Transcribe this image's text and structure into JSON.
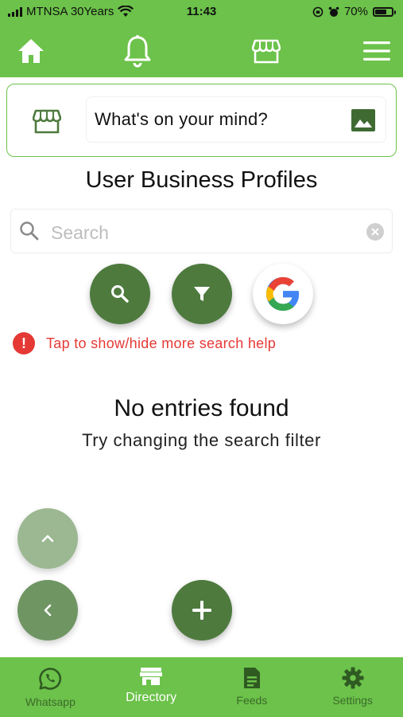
{
  "status_bar": {
    "carrier": "MTNSA 30Years",
    "time": "11:43",
    "battery_percent": "70%",
    "battery_level": 0.7
  },
  "top_nav": {
    "icons": [
      "home-icon",
      "bell-icon",
      "store-icon",
      "menu-icon"
    ]
  },
  "composer": {
    "placeholder": "What's on your mind?"
  },
  "page_title": "User Business Profiles",
  "search": {
    "placeholder": "Search",
    "value": ""
  },
  "help_text": "Tap to show/hide more search help",
  "empty_state": {
    "title": "No entries found",
    "subtitle": "Try changing the search filter"
  },
  "bottom_nav": {
    "items": [
      {
        "label": "Whatsapp",
        "icon": "whatsapp-icon"
      },
      {
        "label": "Directory",
        "icon": "directory-store-icon"
      },
      {
        "label": "Feeds",
        "icon": "feeds-document-icon"
      },
      {
        "label": "Settings",
        "icon": "gear-icon"
      }
    ],
    "active_index": 1
  },
  "colors": {
    "brand_green": "#6cc24a",
    "dark_green": "#4e7a3e",
    "alert_red": "#e53935"
  }
}
